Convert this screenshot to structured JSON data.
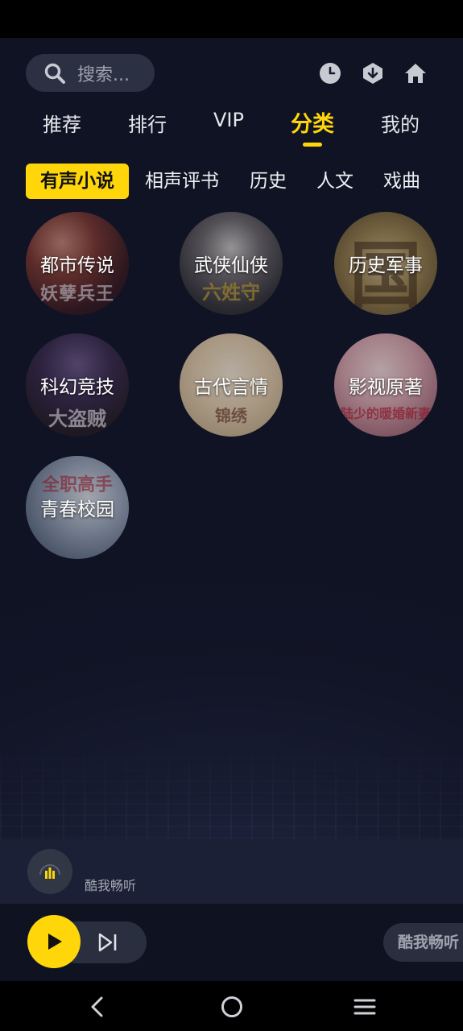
{
  "search": {
    "placeholder": "搜索..."
  },
  "header_icons": [
    "history-icon",
    "download-icon",
    "home-icon"
  ],
  "main_tabs": [
    {
      "label": "推荐",
      "active": false
    },
    {
      "label": "排行",
      "active": false
    },
    {
      "label": "VIP",
      "active": false
    },
    {
      "label": "分类",
      "active": true
    },
    {
      "label": "我的",
      "active": false
    }
  ],
  "sub_tabs": [
    {
      "label": "有声小说",
      "active": true
    },
    {
      "label": "相声评书",
      "active": false
    },
    {
      "label": "历史",
      "active": false
    },
    {
      "label": "人文",
      "active": false
    },
    {
      "label": "戏曲",
      "active": false
    }
  ],
  "categories": [
    {
      "label": "都市传说",
      "cover_text": "妖孽兵王"
    },
    {
      "label": "武侠仙侠",
      "cover_text": "六姓守"
    },
    {
      "label": "历史军事",
      "cover_text": "国"
    },
    {
      "label": "科幻竞技",
      "cover_text": "大盗贼"
    },
    {
      "label": "古代言情",
      "cover_text": "锦绣"
    },
    {
      "label": "影视原著",
      "cover_text": "陆少的暖婚新妻"
    },
    {
      "label": "青春校园",
      "cover_text": "全职高手"
    }
  ],
  "player": {
    "title": "酷我畅听",
    "brand_label": "酷我畅听"
  },
  "colors": {
    "accent": "#ffd60a",
    "background": "#121527",
    "search_bg": "#2b3042"
  }
}
